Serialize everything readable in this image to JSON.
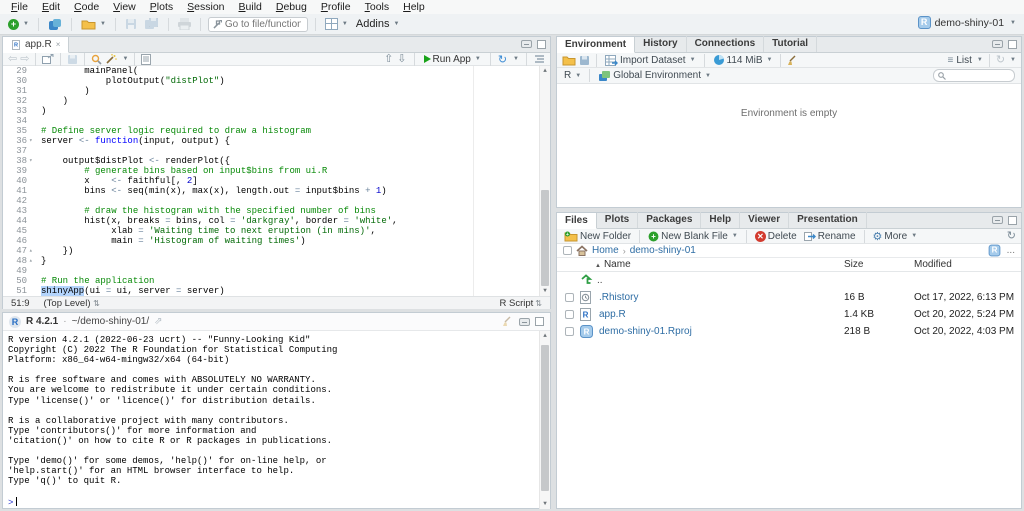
{
  "menu_bar": {
    "items": [
      "File",
      "Edit",
      "Code",
      "View",
      "Plots",
      "Session",
      "Build",
      "Debug",
      "Profile",
      "Tools",
      "Help"
    ]
  },
  "main_toolbar": {
    "goto_placeholder": "Go to file/function",
    "addins_label": "Addins",
    "project_label": "demo-shiny-01"
  },
  "colors": {
    "run_green": "#19a319",
    "link_blue": "#2e6da4",
    "selection": "#b3d4fc",
    "comment_green": "#088a08",
    "string_green": "#036a07",
    "keyword_blue": "#0000ff",
    "number_blue": "#0000cb"
  },
  "source_pane": {
    "tab": "app.R",
    "run_app_label": "Run App",
    "status": {
      "cursor": "51:9",
      "scope": "(Top Level)",
      "file_type": "R Script"
    },
    "code": {
      "lines": [
        {
          "n": 29,
          "fold": "",
          "seg": [
            [
              "p",
              "        mainPanel("
            ]
          ]
        },
        {
          "n": 30,
          "fold": "",
          "seg": [
            [
              "p",
              "            plotOutput("
            ],
            [
              "s",
              "\"distPlot\""
            ],
            [
              "p",
              ")"
            ]
          ]
        },
        {
          "n": 31,
          "fold": "",
          "seg": [
            [
              "p",
              "        )"
            ]
          ]
        },
        {
          "n": 32,
          "fold": "",
          "seg": [
            [
              "p",
              "    )"
            ]
          ]
        },
        {
          "n": 33,
          "fold": "",
          "seg": [
            [
              "p",
              ")"
            ]
          ]
        },
        {
          "n": 34,
          "fold": "",
          "seg": []
        },
        {
          "n": 35,
          "fold": "",
          "seg": [
            [
              "c",
              "# Define server logic required to draw a histogram"
            ]
          ]
        },
        {
          "n": 36,
          "fold": "down",
          "seg": [
            [
              "p",
              "server "
            ],
            [
              "o",
              "<-"
            ],
            [
              "p",
              " "
            ],
            [
              "k",
              "function"
            ],
            [
              "p",
              "(input, output) {"
            ]
          ]
        },
        {
          "n": 37,
          "fold": "",
          "seg": []
        },
        {
          "n": 38,
          "fold": "down",
          "seg": [
            [
              "p",
              "    output$distPlot "
            ],
            [
              "o",
              "<-"
            ],
            [
              "p",
              " renderPlot({"
            ]
          ]
        },
        {
          "n": 39,
          "fold": "",
          "seg": [
            [
              "c",
              "        # generate bins based on input$bins from ui.R"
            ]
          ]
        },
        {
          "n": 40,
          "fold": "",
          "seg": [
            [
              "p",
              "        x    "
            ],
            [
              "o",
              "<-"
            ],
            [
              "p",
              " faithful[, "
            ],
            [
              "n",
              "2"
            ],
            [
              "p",
              "]"
            ]
          ]
        },
        {
          "n": 41,
          "fold": "",
          "seg": [
            [
              "p",
              "        bins "
            ],
            [
              "o",
              "<-"
            ],
            [
              "p",
              " seq(min(x), max(x), length.out "
            ],
            [
              "o",
              "="
            ],
            [
              "p",
              " input$bins "
            ],
            [
              "o",
              "+"
            ],
            [
              "p",
              " "
            ],
            [
              "n",
              "1"
            ],
            [
              "p",
              ")"
            ]
          ]
        },
        {
          "n": 42,
          "fold": "",
          "seg": []
        },
        {
          "n": 43,
          "fold": "",
          "seg": [
            [
              "c",
              "        # draw the histogram with the specified number of bins"
            ]
          ]
        },
        {
          "n": 44,
          "fold": "",
          "seg": [
            [
              "p",
              "        hist(x, breaks "
            ],
            [
              "o",
              "="
            ],
            [
              "p",
              " bins, col "
            ],
            [
              "o",
              "="
            ],
            [
              "p",
              " "
            ],
            [
              "s",
              "'darkgray'"
            ],
            [
              "p",
              ", border "
            ],
            [
              "o",
              "="
            ],
            [
              "p",
              " "
            ],
            [
              "s",
              "'white'"
            ],
            [
              "p",
              ","
            ]
          ]
        },
        {
          "n": 45,
          "fold": "",
          "seg": [
            [
              "p",
              "             xlab "
            ],
            [
              "o",
              "="
            ],
            [
              "p",
              " "
            ],
            [
              "s",
              "'Waiting time to next eruption (in mins)'"
            ],
            [
              "p",
              ","
            ]
          ]
        },
        {
          "n": 46,
          "fold": "",
          "seg": [
            [
              "p",
              "             main "
            ],
            [
              "o",
              "="
            ],
            [
              "p",
              " "
            ],
            [
              "s",
              "'Histogram of waiting times'"
            ],
            [
              "p",
              ")"
            ]
          ]
        },
        {
          "n": 47,
          "fold": "up",
          "seg": [
            [
              "p",
              "    })"
            ]
          ]
        },
        {
          "n": 48,
          "fold": "up",
          "seg": [
            [
              "p",
              "}"
            ]
          ]
        },
        {
          "n": 49,
          "fold": "",
          "seg": []
        },
        {
          "n": 50,
          "fold": "",
          "seg": [
            [
              "c",
              "# Run the application"
            ]
          ]
        },
        {
          "n": 51,
          "fold": "",
          "seg": [
            [
              "sel",
              "shinyApp"
            ],
            [
              "p",
              "(ui "
            ],
            [
              "o",
              "="
            ],
            [
              "p",
              " ui, server "
            ],
            [
              "o",
              "="
            ],
            [
              "p",
              " server)"
            ]
          ]
        }
      ]
    }
  },
  "console_pane": {
    "title": "R 4.2.1",
    "separator": "·",
    "path": "~/demo-shiny-01/",
    "prompt": ">",
    "lines": [
      "R version 4.2.1 (2022-06-23 ucrt) -- \"Funny-Looking Kid\"",
      "Copyright (C) 2022 The R Foundation for Statistical Computing",
      "Platform: x86_64-w64-mingw32/x64 (64-bit)",
      "",
      "R is free software and comes with ABSOLUTELY NO WARRANTY.",
      "You are welcome to redistribute it under certain conditions.",
      "Type 'license()' or 'licence()' for distribution details.",
      "",
      "R is a collaborative project with many contributors.",
      "Type 'contributors()' for more information and",
      "'citation()' on how to cite R or R packages in publications.",
      "",
      "Type 'demo()' for some demos, 'help()' for on-line help, or",
      "'help.start()' for an HTML browser interface to help.",
      "Type 'q()' to quit R.",
      ""
    ]
  },
  "environment_pane": {
    "tabs": [
      "Environment",
      "History",
      "Connections",
      "Tutorial"
    ],
    "active_tab": "Environment",
    "toolbar": {
      "import_label": "Import Dataset",
      "memory_label": "114 MiB",
      "list_label": "List"
    },
    "toolbar2": {
      "r_label": "R",
      "scope_label": "Global Environment"
    },
    "empty_message": "Environment is empty"
  },
  "files_pane": {
    "tabs": [
      "Files",
      "Plots",
      "Packages",
      "Help",
      "Viewer",
      "Presentation"
    ],
    "active_tab": "Files",
    "toolbar": {
      "new_folder": "New Folder",
      "new_blank_file": "New Blank File",
      "delete": "Delete",
      "rename": "Rename",
      "more": "More"
    },
    "breadcrumb": {
      "home": "Home",
      "project": "demo-shiny-01",
      "ellipsis": "..."
    },
    "columns": {
      "name": "Name",
      "size": "Size",
      "modified": "Modified"
    },
    "rows": [
      {
        "icon": "up-dir",
        "name": "..",
        "size": "",
        "modified": "",
        "checkbox": false
      },
      {
        "icon": "rhistory-file",
        "name": ".Rhistory",
        "size": "16 B",
        "modified": "Oct 17, 2022, 6:13 PM",
        "checkbox": true
      },
      {
        "icon": "r-file",
        "name": "app.R",
        "size": "1.4 KB",
        "modified": "Oct 20, 2022, 5:24 PM",
        "checkbox": true
      },
      {
        "icon": "rproj-file",
        "name": "demo-shiny-01.Rproj",
        "size": "218 B",
        "modified": "Oct 20, 2022, 4:03 PM",
        "checkbox": true
      }
    ]
  }
}
